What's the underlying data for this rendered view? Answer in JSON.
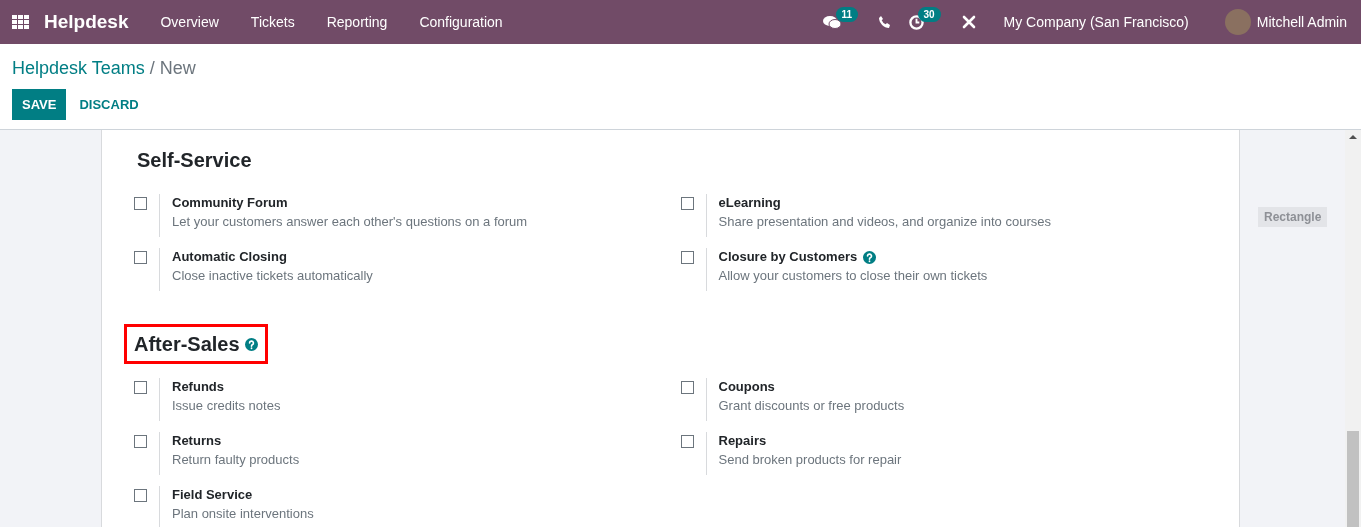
{
  "navbar": {
    "app_name": "Helpdesk",
    "menu": [
      "Overview",
      "Tickets",
      "Reporting",
      "Configuration"
    ],
    "messages_count": "11",
    "activities_count": "30",
    "company": "My Company (San Francisco)",
    "user": "Mitchell Admin"
  },
  "breadcrumb": {
    "parent": "Helpdesk Teams",
    "separator": "/",
    "current": "New"
  },
  "buttons": {
    "save": "SAVE",
    "discard": "DISCARD"
  },
  "sections": [
    {
      "title": "Self-Service",
      "help": false,
      "highlighted": false,
      "settings": [
        {
          "title": "Community Forum",
          "description": "Let your customers answer each other's questions on a forum",
          "checked": false,
          "help": false
        },
        {
          "title": "eLearning",
          "description": "Share presentation and videos, and organize into courses",
          "checked": false,
          "help": false
        },
        {
          "title": "Automatic Closing",
          "description": "Close inactive tickets automatically",
          "checked": false,
          "help": false
        },
        {
          "title": "Closure by Customers",
          "description": "Allow your customers to close their own tickets",
          "checked": false,
          "help": true
        }
      ]
    },
    {
      "title": "After-Sales",
      "help": true,
      "highlighted": true,
      "settings": [
        {
          "title": "Refunds",
          "description": "Issue credits notes",
          "checked": false,
          "help": false
        },
        {
          "title": "Coupons",
          "description": "Grant discounts or free products",
          "checked": false,
          "help": false
        },
        {
          "title": "Returns",
          "description": "Return faulty products",
          "checked": false,
          "help": false
        },
        {
          "title": "Repairs",
          "description": "Send broken products for repair",
          "checked": false,
          "help": false
        },
        {
          "title": "Field Service",
          "description": "Plan onsite interventions",
          "checked": false,
          "help": false
        }
      ]
    }
  ],
  "side_label": "Rectangle"
}
